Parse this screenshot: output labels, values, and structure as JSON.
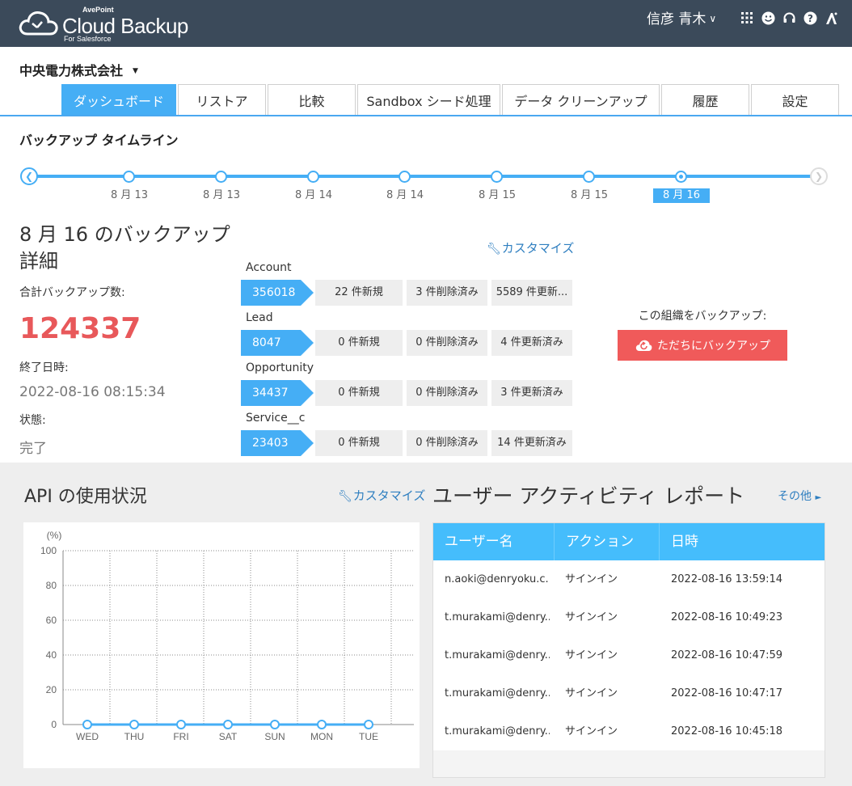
{
  "header": {
    "brand_small": "AvePoint",
    "brand": "Cloud Backup",
    "brand_sub": "For Salesforce",
    "user": "信彦 青木",
    "icons": [
      "apps-grid-icon",
      "smiley-icon",
      "headset-icon",
      "help-icon",
      "avepoint-icon"
    ]
  },
  "org": {
    "name": "中央電力株式会社"
  },
  "tabs": [
    {
      "label": "ダッシュボード",
      "active": true
    },
    {
      "label": "リストア"
    },
    {
      "label": "比較"
    },
    {
      "label": "Sandbox シード処理"
    },
    {
      "label": "データ クリーンアップ"
    },
    {
      "label": "履歴"
    },
    {
      "label": "設定"
    }
  ],
  "timeline": {
    "title": "バックアップ タイムライン",
    "points": [
      {
        "label": "8 月 13"
      },
      {
        "label": "8 月 13"
      },
      {
        "label": "8 月 14"
      },
      {
        "label": "8 月 14"
      },
      {
        "label": "8 月 15"
      },
      {
        "label": "8 月 15"
      },
      {
        "label": "8 月 16",
        "selected": true
      }
    ]
  },
  "detail": {
    "title": "8 月 16 のバックアップ詳細",
    "total_label": "合計バックアップ数:",
    "total_value": "124337",
    "end_label": "終了日時:",
    "end_value": "2022-08-16 08:15:34",
    "status_label": "状態:",
    "status_value": "完了",
    "customize": "カスタマイズ",
    "objects": [
      {
        "name": "Account",
        "count": "356018",
        "new": "22 件新規",
        "deleted": "3 件削除済み",
        "updated": "5589 件更新..."
      },
      {
        "name": "Lead",
        "count": "8047",
        "new": "0 件新規",
        "deleted": "0 件削除済み",
        "updated": "4 件更新済み"
      },
      {
        "name": "Opportunity",
        "count": "34437",
        "new": "0 件新規",
        "deleted": "0 件削除済み",
        "updated": "3 件更新済み"
      },
      {
        "name": "Service__c",
        "count": "23403",
        "new": "0 件新規",
        "deleted": "0 件削除済み",
        "updated": "14 件更新済み"
      }
    ],
    "backup_label": "この組織をバックアップ:",
    "backup_button": "ただちにバックアップ"
  },
  "api": {
    "title": "API の使用状況",
    "customize": "カスタマイズ"
  },
  "chart_data": {
    "type": "line",
    "title": "",
    "ylabel": "(%)",
    "xlabel": "",
    "categories": [
      "WED",
      "THU",
      "FRI",
      "SAT",
      "SUN",
      "MON",
      "TUE"
    ],
    "series": [
      {
        "values": [
          0,
          0,
          0,
          0,
          0,
          0,
          0
        ]
      }
    ],
    "ylim": [
      0,
      100
    ],
    "yticks": [
      "100",
      "80",
      "60",
      "40",
      "20",
      "0"
    ],
    "grid": true,
    "line_color": "#45aef5"
  },
  "activity": {
    "title": "ユーザー アクティビティ レポート",
    "more": "その他",
    "columns": [
      "ユーザー名",
      "アクション",
      "日時"
    ],
    "rows": [
      {
        "user": "n.aoki@denryoku.c...",
        "action": "サインイン",
        "time": "2022-08-16 13:59:14"
      },
      {
        "user": "t.murakami@denry...",
        "action": "サインイン",
        "time": "2022-08-16 10:49:23"
      },
      {
        "user": "t.murakami@denry...",
        "action": "サインイン",
        "time": "2022-08-16 10:47:59"
      },
      {
        "user": "t.murakami@denry...",
        "action": "サインイン",
        "time": "2022-08-16 10:47:17"
      },
      {
        "user": "t.murakami@denry...",
        "action": "サインイン",
        "time": "2022-08-16 10:45:18"
      }
    ]
  },
  "colors": {
    "accent": "#45aef5",
    "header_bg": "#3b4a5a",
    "danger": "#f05a5a",
    "total": "#e8585a"
  }
}
